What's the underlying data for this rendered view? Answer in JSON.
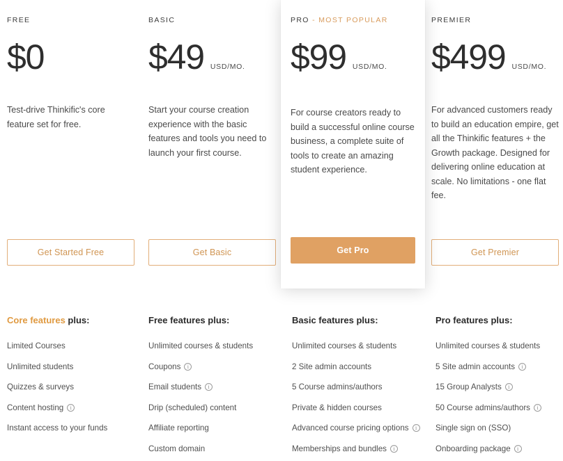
{
  "plans": [
    {
      "name": "FREE",
      "name_suffix": "",
      "price": "$0",
      "unit": "",
      "description": "Test-drive Thinkific's core feature set for free.",
      "cta": "Get Started Free",
      "featured": false
    },
    {
      "name": "BASIC",
      "name_suffix": "",
      "price": "$49",
      "unit": "USD/MO.",
      "description": "Start your course creation experience with the basic features and tools you need to launch your first course.",
      "cta": "Get Basic",
      "featured": false
    },
    {
      "name": "PRO",
      "name_suffix": "- MOST POPULAR",
      "price": "$99",
      "unit": "USD/MO.",
      "description": "For course creators ready to build a successful online course business, a complete suite of tools to create an amazing student experience.",
      "cta": "Get Pro",
      "featured": true
    },
    {
      "name": "PREMIER",
      "name_suffix": "",
      "price": "$499",
      "unit": "USD/MO.",
      "description": "For advanced customers ready to build an education empire, get all the Thinkific features + the Growth package. Designed for delivering online education at scale. No limitations - one flat fee.",
      "cta": "Get Premier",
      "featured": false
    }
  ],
  "feature_columns": [
    {
      "heading_accent": "Core features",
      "heading_rest": " plus:",
      "items": [
        {
          "label": "Limited Courses",
          "info": false
        },
        {
          "label": "Unlimited students",
          "info": false
        },
        {
          "label": "Quizzes & surveys",
          "info": false
        },
        {
          "label": "Content hosting",
          "info": true
        },
        {
          "label": "Instant access to your funds",
          "info": false
        }
      ]
    },
    {
      "heading_accent": "",
      "heading_rest": "Free features plus:",
      "items": [
        {
          "label": "Unlimited courses & students",
          "info": false
        },
        {
          "label": "Coupons",
          "info": true
        },
        {
          "label": "Email students",
          "info": true
        },
        {
          "label": "Drip (scheduled) content",
          "info": false
        },
        {
          "label": "Affiliate reporting",
          "info": false
        },
        {
          "label": "Custom domain",
          "info": false
        }
      ]
    },
    {
      "heading_accent": "",
      "heading_rest": "Basic features plus:",
      "items": [
        {
          "label": "Unlimited courses & students",
          "info": false
        },
        {
          "label": "2 Site admin accounts",
          "info": false
        },
        {
          "label": "5 Course admins/authors",
          "info": false
        },
        {
          "label": "Private & hidden courses",
          "info": false
        },
        {
          "label": "Advanced course pricing options",
          "info": true
        },
        {
          "label": "Memberships and bundles",
          "info": true
        }
      ]
    },
    {
      "heading_accent": "",
      "heading_rest": "Pro features plus:",
      "items": [
        {
          "label": "Unlimited courses & students",
          "info": false
        },
        {
          "label": "5 Site admin accounts",
          "info": true
        },
        {
          "label": "15 Group Analysts",
          "info": true
        },
        {
          "label": "50 Course admins/authors",
          "info": true
        },
        {
          "label": "Single sign on (SSO)",
          "info": false
        },
        {
          "label": "Onboarding package",
          "info": true
        }
      ]
    }
  ],
  "colors": {
    "accent": "#e09a41",
    "cta_border": "#e2ae79",
    "cta_text": "#d09553",
    "cta_filled_bg": "#e0a163",
    "popular_badge": "#d89b5c"
  }
}
